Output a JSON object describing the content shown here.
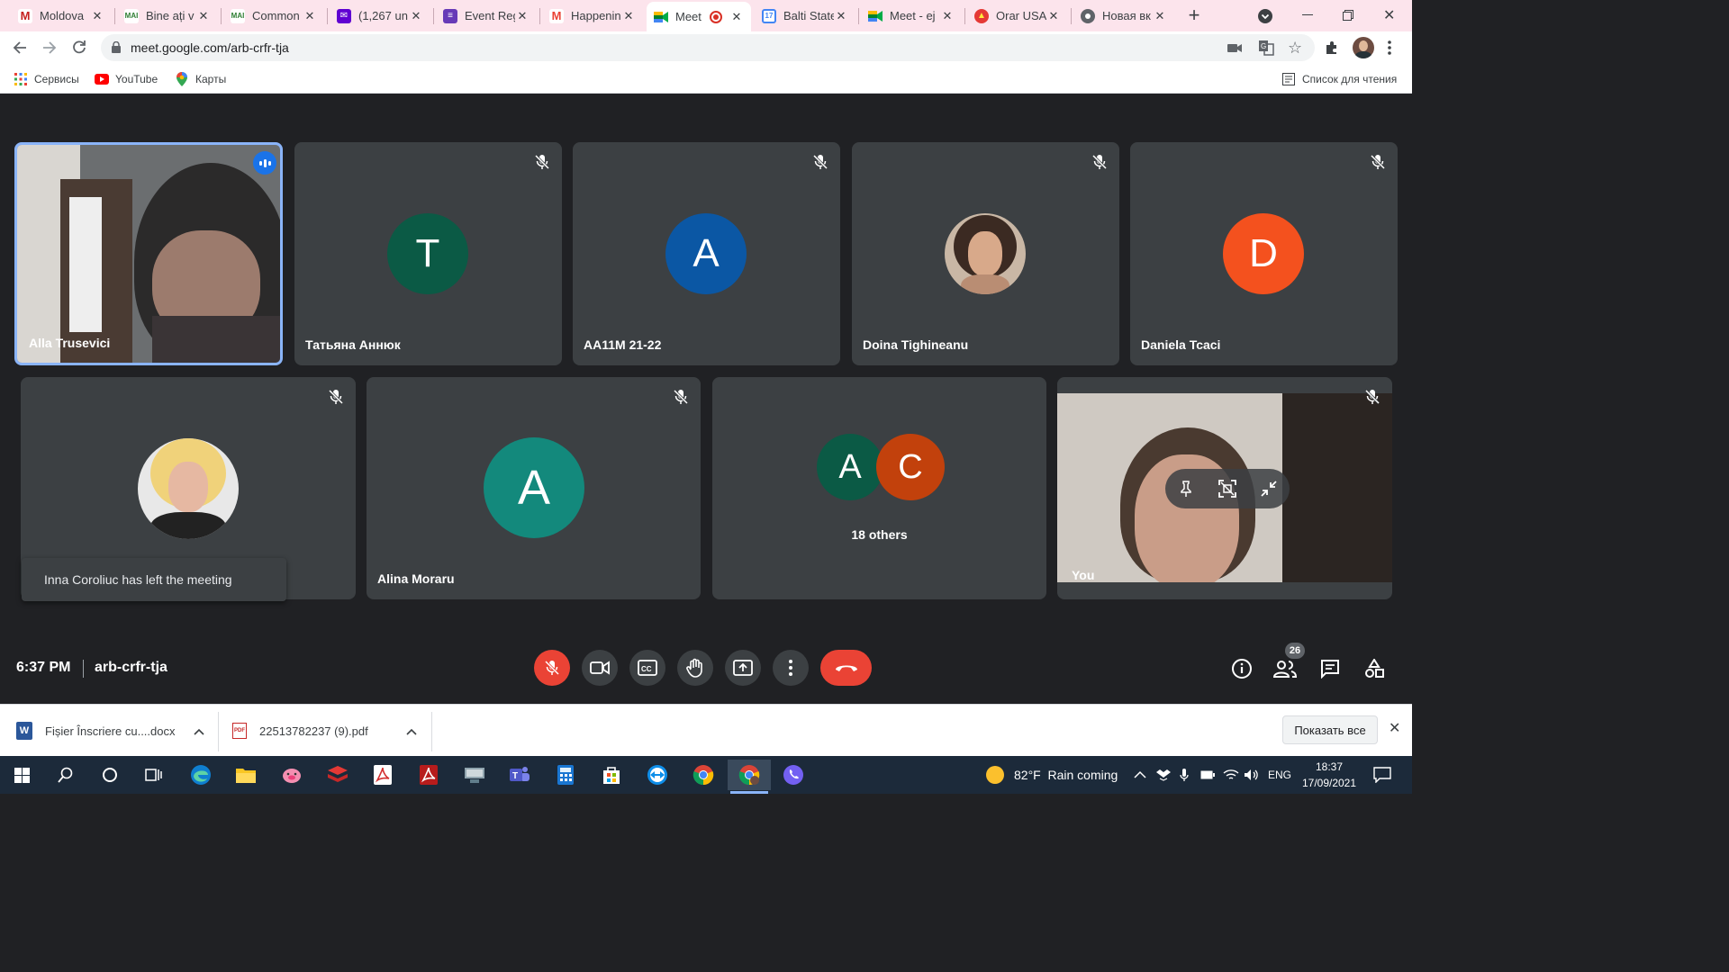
{
  "browser": {
    "tabs": [
      {
        "title": "Moldova",
        "favicon": "gmail-m-icon",
        "color": "#ffffff"
      },
      {
        "title": "Bine ați v",
        "favicon": "mail-icon",
        "color": "#ffffff"
      },
      {
        "title": "Common",
        "favicon": "mail-icon",
        "color": "#ffffff"
      },
      {
        "title": "(1,267 un",
        "favicon": "yahoo-icon",
        "color": "#6001d2"
      },
      {
        "title": "Event Reg",
        "favicon": "forms-icon",
        "color": "#673ab7"
      },
      {
        "title": "Happenin",
        "favicon": "gmail-icon",
        "color": "#ffffff"
      },
      {
        "title": "Meet",
        "favicon": "meet-icon",
        "color": "#ffffff"
      },
      {
        "title": "Balti State",
        "favicon": "calendar-icon",
        "color": "#ffffff"
      },
      {
        "title": "Meet - ej",
        "favicon": "meet-icon",
        "color": "#ffffff"
      },
      {
        "title": "Orar USA",
        "favicon": "orar-icon",
        "color": "#ffffff"
      },
      {
        "title": "Новая вк",
        "favicon": "chrome-icon",
        "color": "#ffffff"
      }
    ],
    "url": "meet.google.com/arb-crfr-tja",
    "bookmarks": [
      {
        "label": "Сервисы"
      },
      {
        "label": "YouTube"
      },
      {
        "label": "Карты"
      }
    ],
    "reading_list": "Список для чтения"
  },
  "meeting": {
    "participants_top": [
      {
        "name": "Alla Trusevici",
        "type": "video"
      },
      {
        "name": "Татьяна Аннюк",
        "initial": "T",
        "color": "#0b5a45"
      },
      {
        "name": "AA11M 21-22",
        "initial": "A",
        "color": "#0b57a4"
      },
      {
        "name": "Doina Tighineanu",
        "type": "photo"
      },
      {
        "name": "Daniela Tcaci",
        "initial": "D",
        "color": "#f4511e"
      }
    ],
    "participants_bottom": [
      {
        "name": "Inna Coroliuc",
        "type": "photo"
      },
      {
        "name": "Alina Moraru",
        "initial": "A",
        "color": "#13897c"
      },
      {
        "name": "18 others",
        "initials": [
          "A",
          "C"
        ],
        "colors": [
          "#0b5a45",
          "#c2410c"
        ]
      },
      {
        "name": "You",
        "type": "video"
      }
    ],
    "toast": "Inna Coroliuc has left the meeting",
    "time": "6:37 PM",
    "code": "arb-crfr-tja",
    "participant_count": "26"
  },
  "downloads": {
    "items": [
      {
        "name": "Fișier Înscriere cu....docx"
      },
      {
        "name": "22513782237 (9).pdf"
      }
    ],
    "show_all": "Показать все"
  },
  "taskbar": {
    "weather": "82°F  Rain coming",
    "lang": "ENG",
    "time": "18:37",
    "date": "17/09/2021"
  }
}
